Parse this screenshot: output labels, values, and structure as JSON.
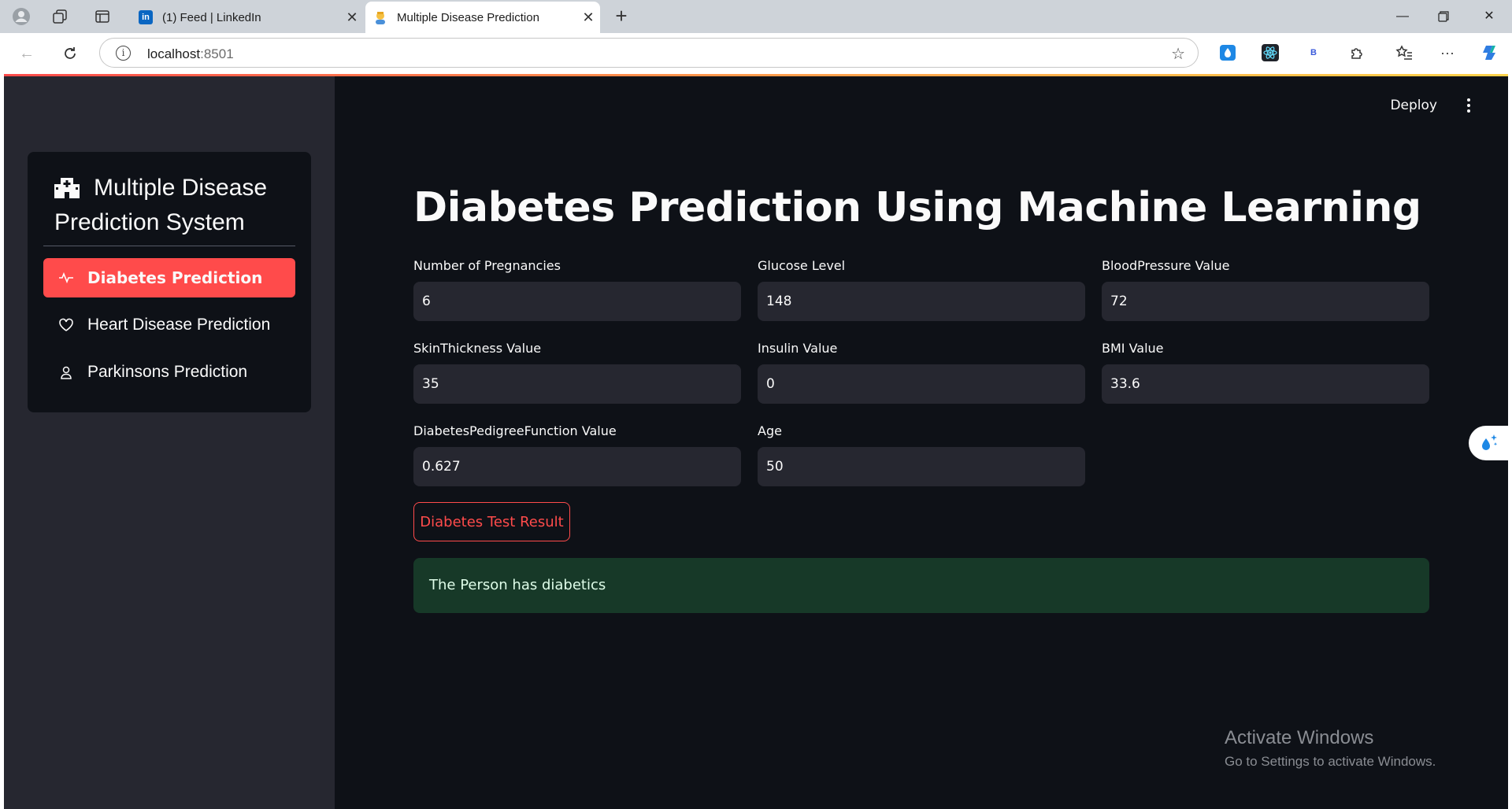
{
  "browser": {
    "tabs": [
      {
        "title": "(1) Feed | LinkedIn",
        "favicon": "linkedin-icon",
        "active": false
      },
      {
        "title": "Multiple Disease Prediction",
        "favicon": "person-emoji-icon",
        "active": true
      }
    ],
    "url_host": "localhost",
    "url_port": ":8501",
    "extension_b_label": "B"
  },
  "app": {
    "deploy_label": "Deploy",
    "sidebar": {
      "title": "Multiple Disease Prediction System",
      "items": [
        {
          "label": "Diabetes Prediction",
          "icon": "activity-icon",
          "active": true
        },
        {
          "label": "Heart Disease Prediction",
          "icon": "heart-icon",
          "active": false
        },
        {
          "label": "Parkinsons Prediction",
          "icon": "person-icon",
          "active": false
        }
      ]
    },
    "page_title": "Diabetes Prediction Using Machine Learning",
    "fields": [
      {
        "label": "Number of Pregnancies",
        "value": "6"
      },
      {
        "label": "Glucose Level",
        "value": "148"
      },
      {
        "label": "BloodPressure Value",
        "value": "72"
      },
      {
        "label": "SkinThickness Value",
        "value": "35"
      },
      {
        "label": "Insulin Value",
        "value": "0"
      },
      {
        "label": "BMI Value",
        "value": "33.6"
      },
      {
        "label": "DiabetesPedigreeFunction Value",
        "value": "0.627"
      },
      {
        "label": "Age",
        "value": "50"
      }
    ],
    "button_label": "Diabetes Test Result",
    "result_text": "The Person has diabetics",
    "colors": {
      "accent": "#ff4b4b",
      "background": "#0e1117",
      "sidebar": "#262730",
      "success_bg": "#173928"
    }
  },
  "watermark": {
    "line1": "Activate Windows",
    "line2": "Go to Settings to activate Windows."
  }
}
